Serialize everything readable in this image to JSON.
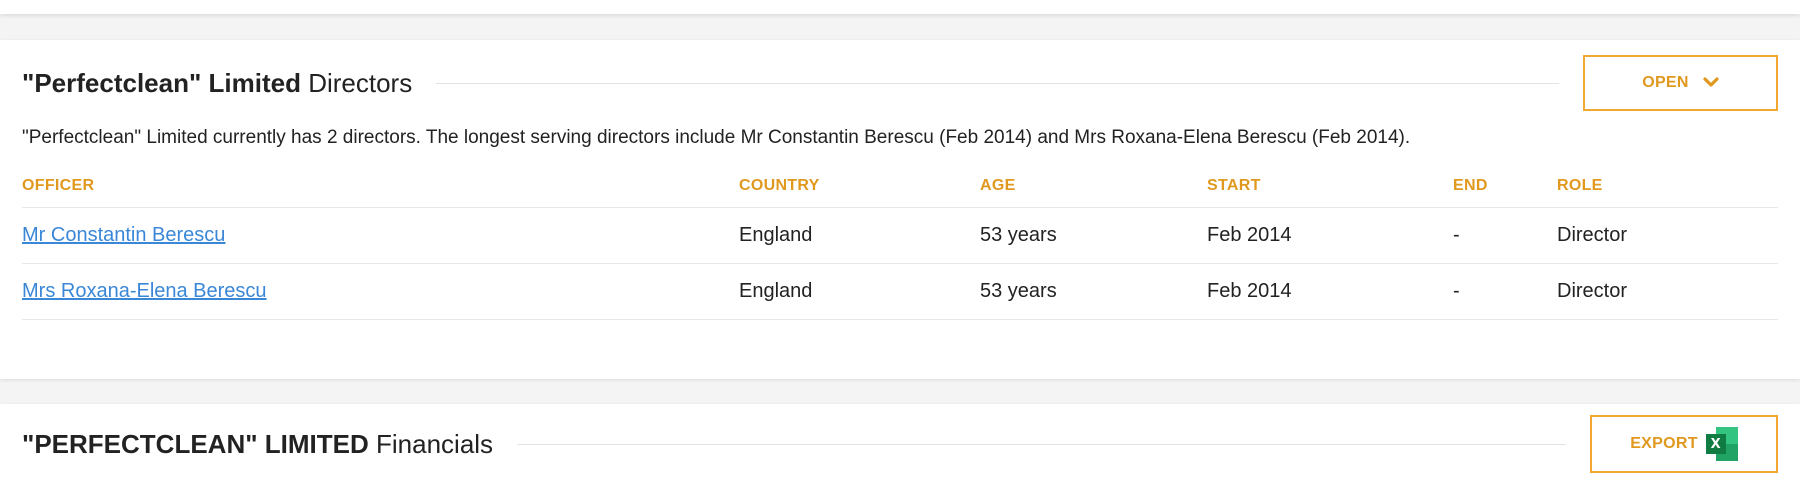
{
  "directors_section": {
    "title_bold": "\"Perfectclean\" Limited",
    "title_plain": "Directors",
    "open_button": "OPEN",
    "summary": "\"Perfectclean\" Limited currently has 2 directors. The longest serving directors include Mr Constantin Berescu (Feb 2014) and Mrs Roxana-Elena Berescu (Feb 2014).",
    "columns": [
      "OFFICER",
      "COUNTRY",
      "AGE",
      "START",
      "END",
      "ROLE"
    ],
    "rows": [
      {
        "officer": "Mr Constantin Berescu",
        "country": "England",
        "age": "53 years",
        "start": "Feb 2014",
        "end": "-",
        "role": "Director"
      },
      {
        "officer": "Mrs Roxana-Elena Berescu",
        "country": "England",
        "age": "53 years",
        "start": "Feb 2014",
        "end": "-",
        "role": "Director"
      }
    ]
  },
  "financials_section": {
    "title_bold": "\"PERFECTCLEAN\" LIMITED",
    "title_plain": "Financials",
    "export_button": "EXPORT",
    "export_icon": "excel-icon",
    "export_icon_letter": "X"
  },
  "colors": {
    "accent": "#e0991e",
    "link": "#3a87d8",
    "excel_green": "#107c41"
  }
}
